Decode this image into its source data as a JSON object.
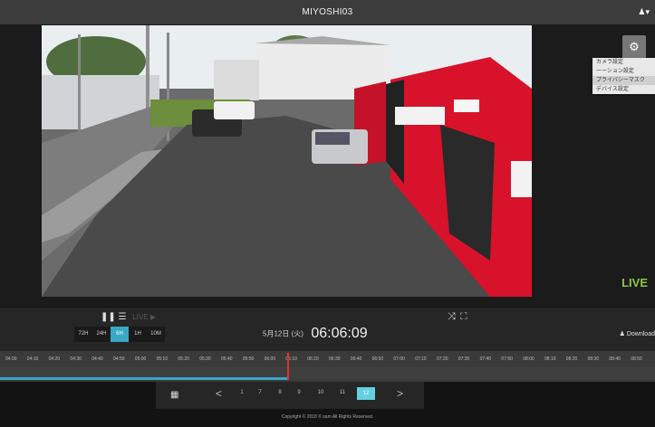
{
  "header": {
    "title": "MIYOSHI03",
    "user_icon": "user-icon"
  },
  "viewer": {
    "live_label": "LIVE",
    "settings_menu": [
      "カメラ設定",
      "ーーション設定",
      "プライバシーマスク",
      "デバイス設定"
    ],
    "settings_menu_selected": 2
  },
  "controls": {
    "live_label": "LIVE",
    "speeds": [
      "72H",
      "24H",
      "6H",
      "1H",
      "10M"
    ],
    "active_speed": "6H",
    "date_text": "5月12日 (火)",
    "time_text": "06:06:09",
    "download_label": "Download"
  },
  "timeline": {
    "ticks": [
      "04:00",
      "04:10",
      "04:20",
      "04:30",
      "04:40",
      "04:50",
      "05:00",
      "05:10",
      "05:20",
      "05:30",
      "05:40",
      "05:50",
      "06:00",
      "06:10",
      "06:20",
      "06:30",
      "06:40",
      "06:50",
      "07:00",
      "07:10",
      "07:20",
      "07:30",
      "07:40",
      "07:50",
      "08:00",
      "08:10",
      "08:20",
      "08:30",
      "08:40",
      "08:50"
    ],
    "progress_fraction": 0.44
  },
  "pager": {
    "prev": "<",
    "pages": [
      "1",
      "7",
      "8",
      "9",
      "10",
      "11",
      "12"
    ],
    "current": "12",
    "next": ">"
  },
  "footer": {
    "copyright": "Copyright © 2018 © sam All Rights Reserved."
  }
}
